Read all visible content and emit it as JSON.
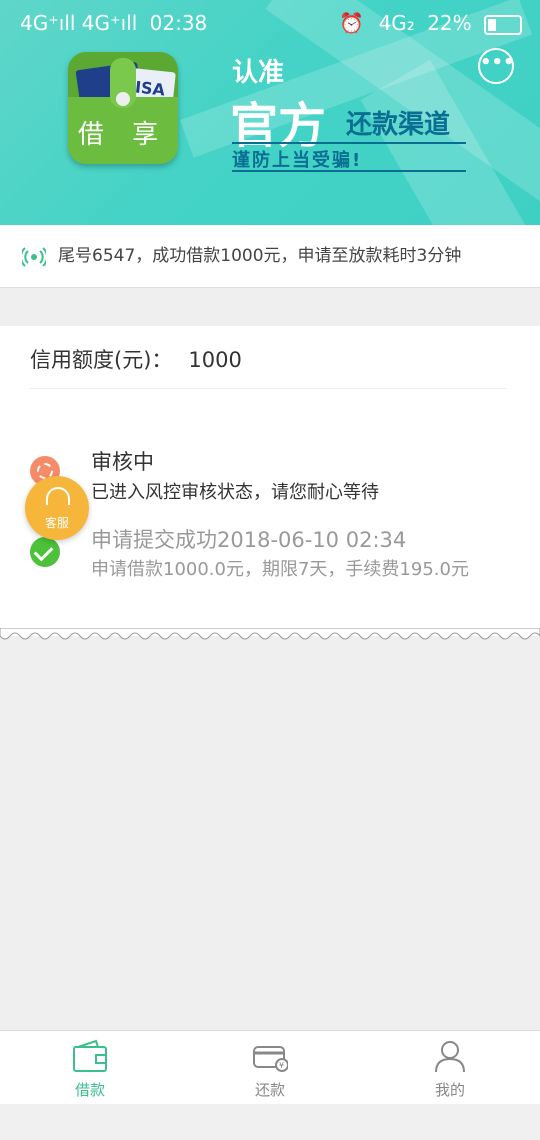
{
  "status_bar": {
    "signal_left": "4G⁺ıll 4G⁺ıll",
    "time": "02:38",
    "network": "4G₂",
    "battery": "22%"
  },
  "banner": {
    "logo_card_text": "ISA",
    "logo_word": "借 享",
    "slogan_top": "认准",
    "slogan_main": "官方",
    "slogan_sub": "还款渠道",
    "slogan_warning": "谨防上当受骗!",
    "more_icon": "more-dots-icon"
  },
  "notice": {
    "icon": "broadcast-icon",
    "text": "尾号6547，成功借款1000元，申请至放款耗时3分钟"
  },
  "credit": {
    "label": "信用额度(元)：",
    "value": "1000"
  },
  "steps": [
    {
      "title": "审核中",
      "desc": "已进入风控审核状态，请您耐心等待"
    },
    {
      "title": "申请提交成功2018-06-10 02:34",
      "desc": "申请借款1000.0元，期限7天，手续费195.0元"
    }
  ],
  "service": {
    "label": "客服"
  },
  "tabs": [
    {
      "label": "借款",
      "icon": "wallet-icon",
      "active": true
    },
    {
      "label": "还款",
      "icon": "card-repay-icon",
      "active": false
    },
    {
      "label": "我的",
      "icon": "user-icon",
      "active": false
    }
  ],
  "colors": {
    "banner": "#44d3c6",
    "accent_green": "#3bbf8d",
    "pending_orange": "#f68b6a",
    "done_green": "#4cc13a",
    "service_yellow": "#f6b63b"
  }
}
